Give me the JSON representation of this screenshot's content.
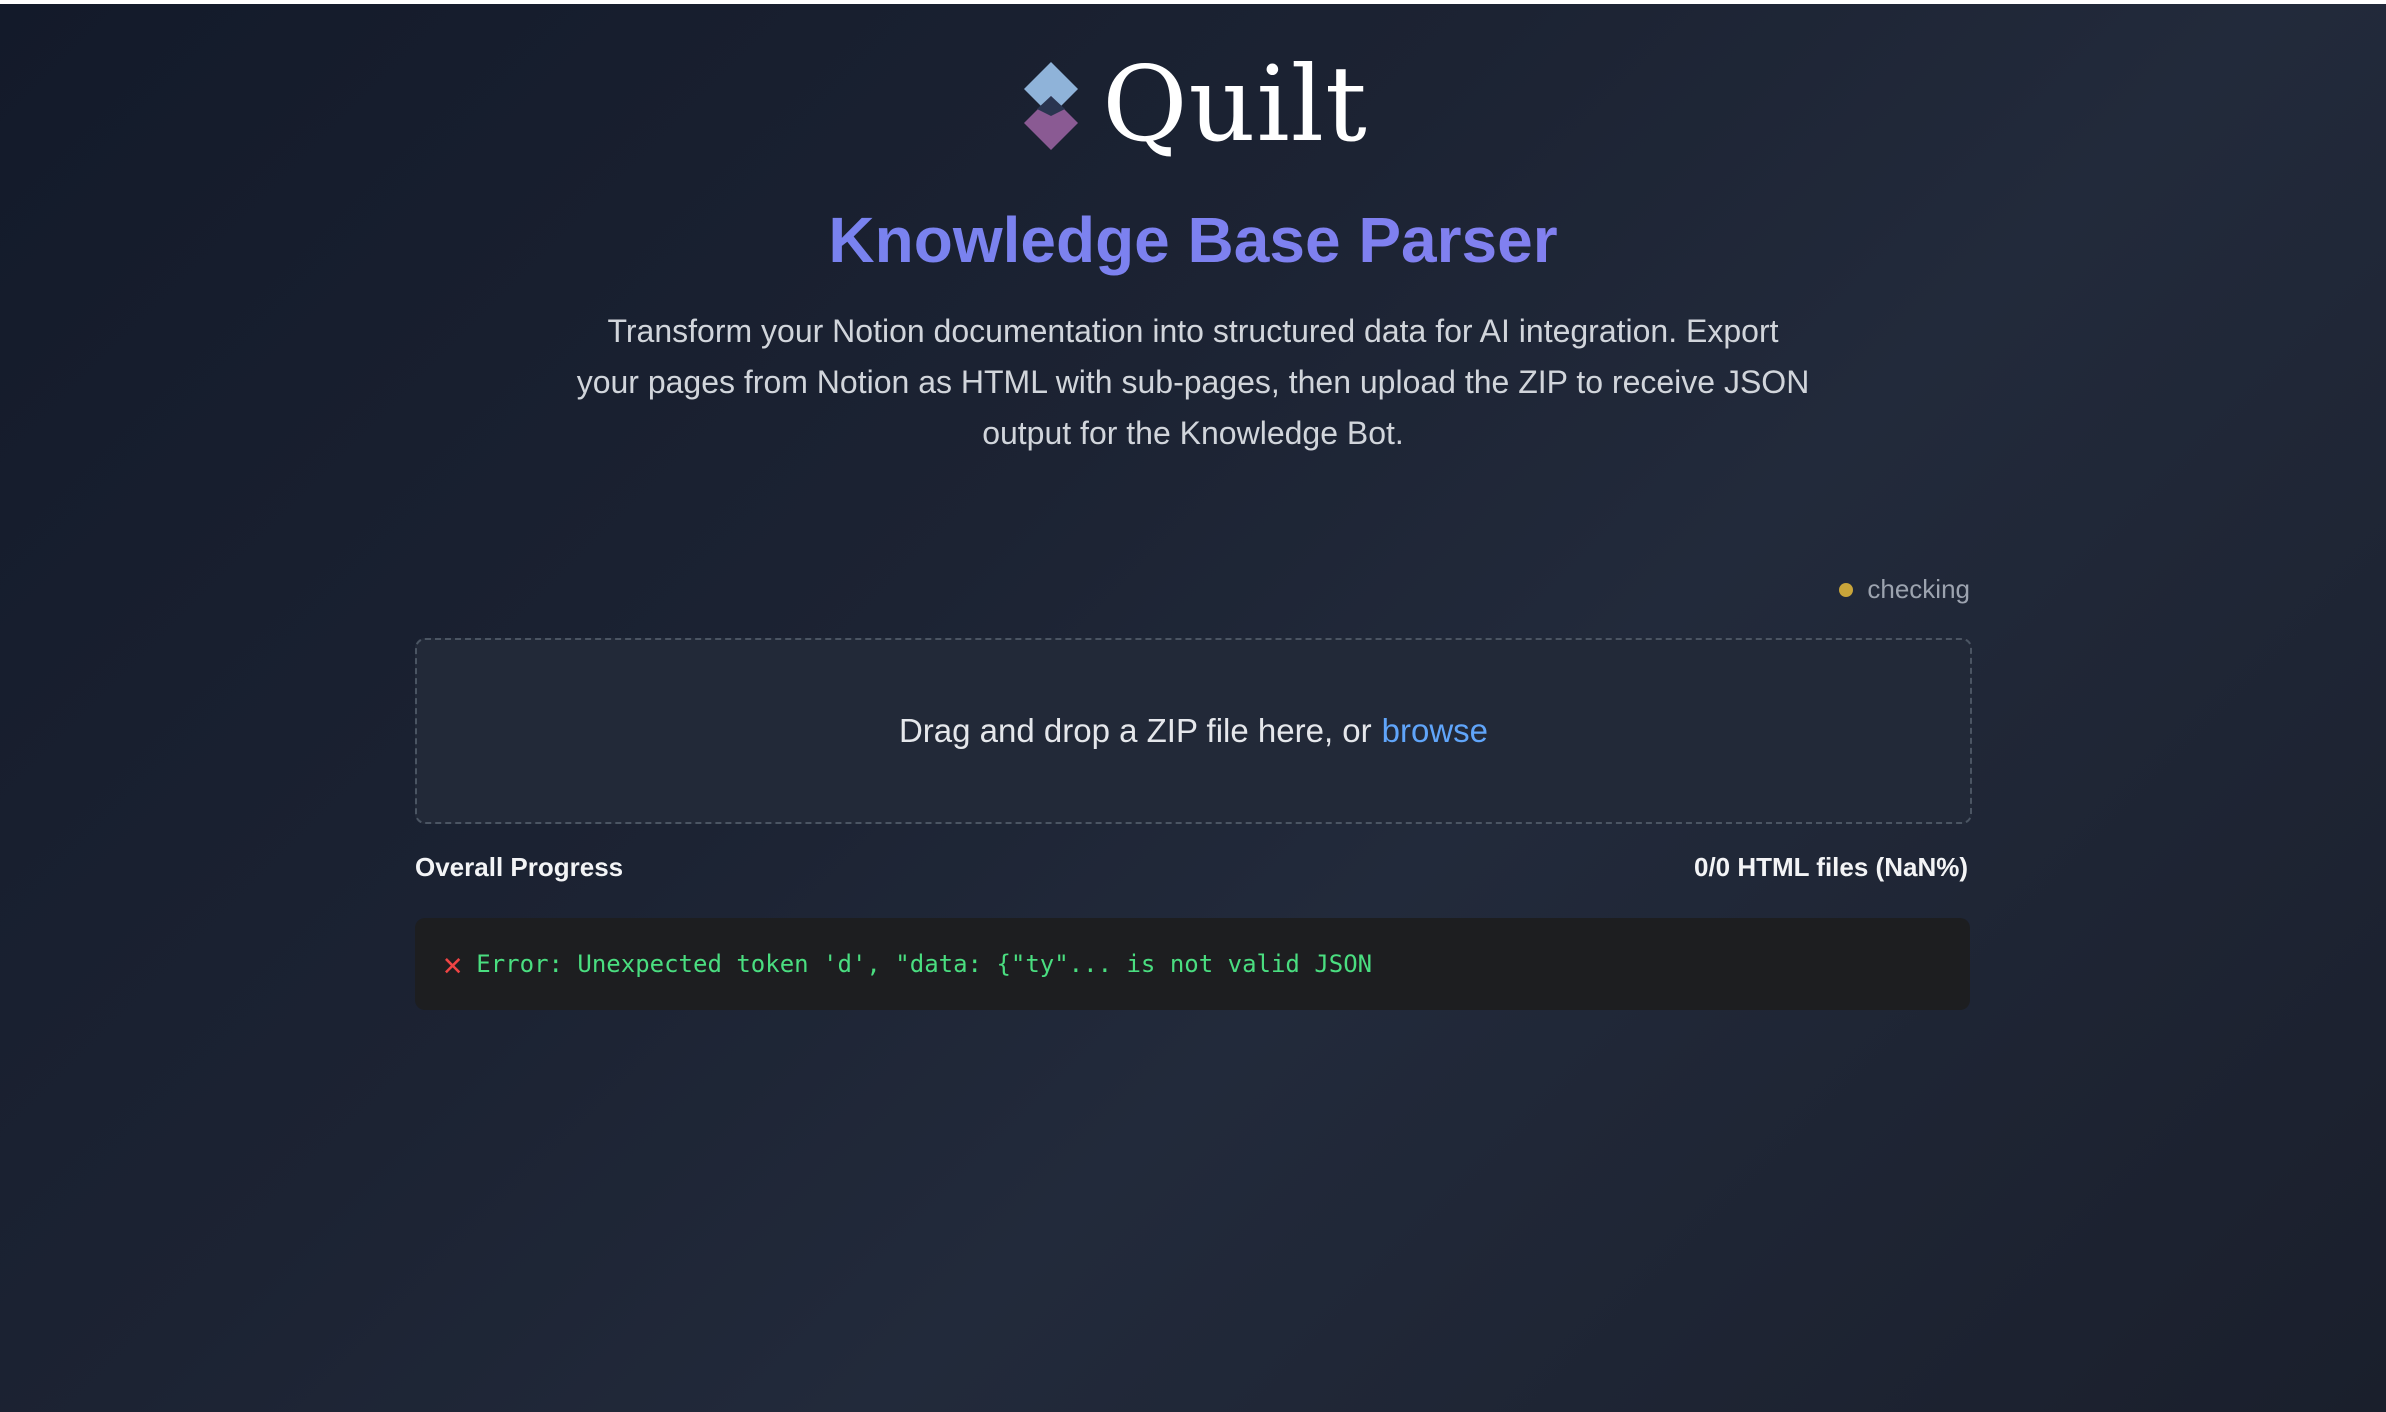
{
  "brand": {
    "name": "Quilt",
    "logo_icon": "quilt-diamond-logo"
  },
  "header": {
    "title": "Knowledge Base Parser",
    "description": "Transform your Notion documentation into structured data for AI integration. Export your pages from Notion as HTML with sub-pages, then upload the ZIP to receive JSON output for the Knowledge Bot."
  },
  "status": {
    "label": "checking",
    "color": "#c9a53a"
  },
  "upload": {
    "prompt": "Drag and drop a ZIP file here, or",
    "browse_label": "browse"
  },
  "progress": {
    "label": "Overall Progress",
    "value_text": "0/0 HTML files (NaN%)"
  },
  "log": {
    "icon": "error-x-icon",
    "message": "Error: Unexpected token 'd', \"data: {\"ty\"... is not valid JSON"
  },
  "colors": {
    "title_gradient_start": "#6f86ee",
    "title_gradient_end": "#8b7cf0",
    "link": "#60a5fa",
    "log_text": "#4ade80",
    "error_icon": "#ef4444"
  }
}
